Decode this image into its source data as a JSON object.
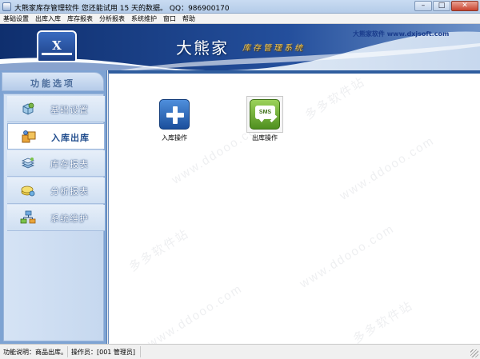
{
  "window": {
    "title": "大熊家库存管理软件    您还能试用 15 天的数据。    QQ：986900170",
    "minimize_glyph": "–",
    "maximize_glyph": "□",
    "close_glyph": "✕"
  },
  "menu": {
    "items": [
      {
        "label": "基础设置"
      },
      {
        "label": "出库入库"
      },
      {
        "label": "库存报表"
      },
      {
        "label": "分析报表"
      },
      {
        "label": "系统维护"
      },
      {
        "label": "窗口"
      },
      {
        "label": "帮助"
      }
    ]
  },
  "banner": {
    "logo_text": "X",
    "brand": "大熊家",
    "subtitle": "库存管理系统",
    "site": "大熊家软件 www.dxjsoft.com"
  },
  "sidebar": {
    "title": "功能选项",
    "items": [
      {
        "label": "基础设置",
        "icon": "settings-cube-icon",
        "active": false
      },
      {
        "label": "入库出库",
        "icon": "boxes-icon",
        "active": true
      },
      {
        "label": "库存报表",
        "icon": "stack-icon",
        "active": false
      },
      {
        "label": "分析报表",
        "icon": "coins-icon",
        "active": false
      },
      {
        "label": "系统维护",
        "icon": "network-icon",
        "active": false
      }
    ]
  },
  "main": {
    "actions": [
      {
        "label": "入库操作",
        "icon": "plus-icon"
      },
      {
        "label": "出库操作",
        "icon": "sms-icon",
        "icon_text": "SMS"
      }
    ],
    "watermarks": [
      "多多软件站",
      "www.ddooo.com"
    ]
  },
  "status": {
    "function_text": "功能说明：商品出库。",
    "operator_text": "操作员：[001 管理员]"
  },
  "colors": {
    "accent_blue": "#2f5d9e",
    "sidebar_bg": "#7ea3d3",
    "subtitle_gold": "#f4c64a"
  }
}
